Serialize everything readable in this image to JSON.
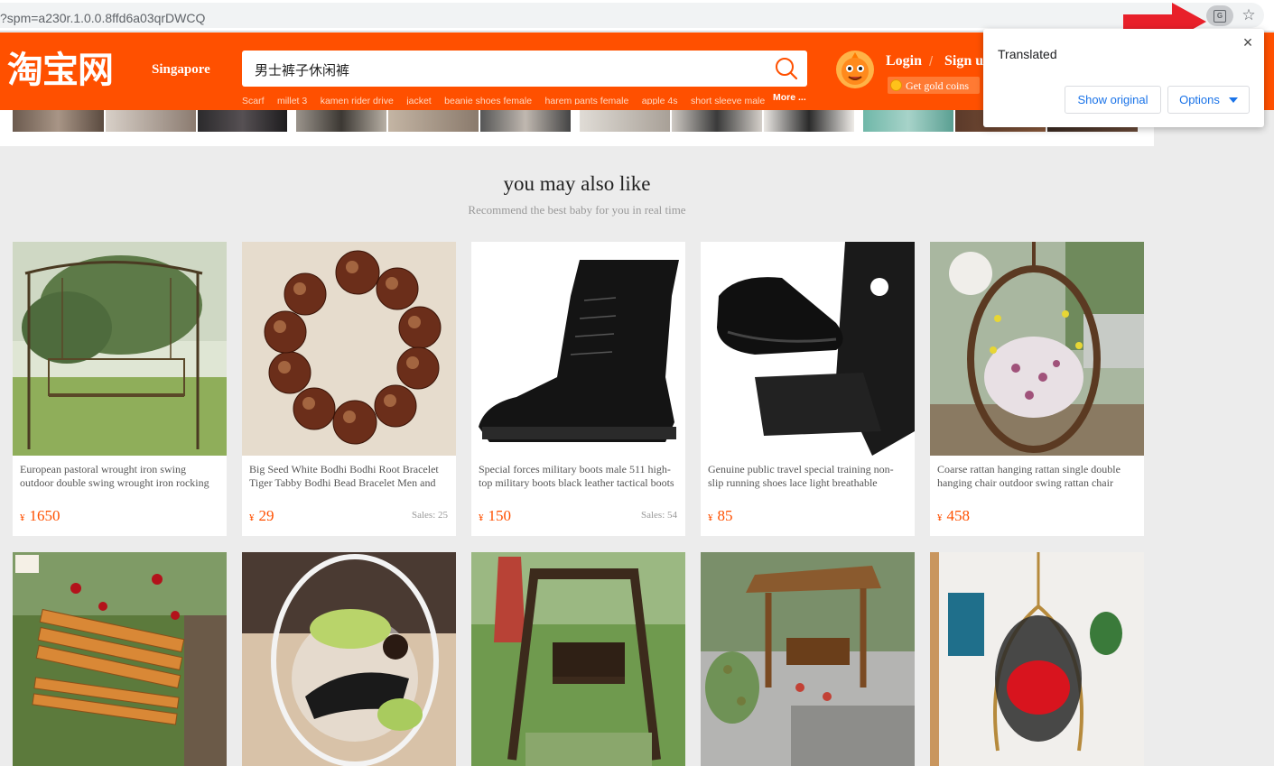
{
  "browser": {
    "url": "?spm=a230r.1.0.0.8ffd6a03qrDWCQ"
  },
  "header": {
    "logo": "淘宝网",
    "region": "Singapore",
    "search_value": "男士裤子休闲裤",
    "hot_searches": [
      "Scarf",
      "millet 3",
      "kamen rider drive",
      "jacket",
      "beanie shoes female",
      "harem pants female",
      "apple 4s",
      "short sleeve male"
    ],
    "more_label": "More ...",
    "login_label": "Login",
    "separator": "/",
    "signup_label": "Sign u",
    "coins_label": "Get gold coins",
    "brand_color": "#ff5000"
  },
  "section": {
    "title": "you may also like",
    "subtitle": "Recommend the best baby for you in real time"
  },
  "products": [
    {
      "title": "European pastoral wrought iron swing outdoor double swing wrought iron rocking chair",
      "currency": "¥",
      "price": "1650",
      "sales": ""
    },
    {
      "title": "Big Seed White Bodhi Bodhi Root Bracelet Tiger Tabby Bodhi Bead Bracelet Men and Women",
      "currency": "¥",
      "price": "29",
      "sales": "Sales: 25"
    },
    {
      "title": "Special forces military boots male 511 high-top military boots black leather tactical boots",
      "currency": "¥",
      "price": "150",
      "sales": "Sales: 54"
    },
    {
      "title": "Genuine public travel special training non-slip running shoes lace light breathable sneakers",
      "currency": "¥",
      "price": "85",
      "sales": ""
    },
    {
      "title": "Coarse rattan hanging rattan single double hanging chair outdoor swing rattan chair basket",
      "currency": "¥",
      "price": "458",
      "sales": ""
    },
    {
      "title": "",
      "currency": "",
      "price": "",
      "sales": ""
    },
    {
      "title": "",
      "currency": "",
      "price": "",
      "sales": ""
    },
    {
      "title": "",
      "currency": "",
      "price": "",
      "sales": ""
    },
    {
      "title": "",
      "currency": "",
      "price": "",
      "sales": ""
    },
    {
      "title": "",
      "currency": "",
      "price": "",
      "sales": ""
    }
  ],
  "translate_popup": {
    "title": "Translated",
    "close": "×",
    "show_original": "Show original",
    "options": "Options"
  }
}
